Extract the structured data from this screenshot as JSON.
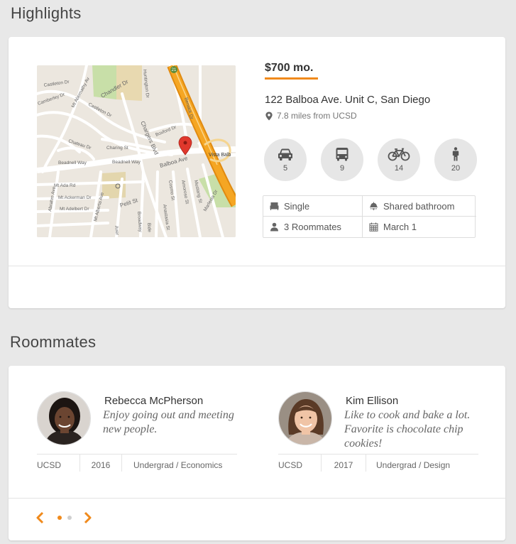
{
  "highlights": {
    "title": "Highlights",
    "price": "$700 mo.",
    "address": "122 Balboa Ave. Unit C, San Diego",
    "distance": "7.8 miles from UCSD",
    "transit": [
      {
        "icon": "car-icon",
        "value": "5"
      },
      {
        "icon": "bus-icon",
        "value": "9"
      },
      {
        "icon": "bicycle-icon",
        "value": "14"
      },
      {
        "icon": "walking-icon",
        "value": "20"
      }
    ],
    "features": [
      {
        "icon": "bed-icon",
        "label": "Single"
      },
      {
        "icon": "shower-icon",
        "label": "Shared bathroom"
      },
      {
        "icon": "person-icon",
        "label": "3 Roommates"
      },
      {
        "icon": "calendar-icon",
        "label": "March 1"
      }
    ],
    "map": {
      "labels": {
        "castleton1": "Castleton Dr",
        "castleton2": "Castleton Dr",
        "mt_abernathy": "Mt Abernathy Av",
        "chandler": "Chandler Dr",
        "chateau": "Chateau Dr",
        "charing": "Charing St",
        "chargers": "Chargers Blvd",
        "boxford": "Boxford Dr",
        "balboa": "Balboa Ave",
        "beadnell1": "Beadnell Way",
        "beadnell2": "Beadnell Way",
        "vista": "Vista Balb",
        "mt_ada": "Mt Ada Rd",
        "mt_ackerman": "Mt Ackerman Dr",
        "mt_adelbert": "Mt Adelbert Dr",
        "petit": "Petit St",
        "cosmo": "Cosmo St",
        "amoroso": "Amoroso St",
        "mustang": "Mustang St",
        "anastasia": "Anastasia St",
        "marlesta": "Marlesta Dr",
        "berwick": "Berwick Dr",
        "huntington": "Huntington Dr",
        "abrahm": "Abrahm Ave",
        "mt_alberta": "Mt Alberta Ave",
        "broadway": "Broadway",
        "avenue": "Aver",
        "hwy": "21",
        "camberley": "Camberley Dr",
        "bide": "Bide"
      },
      "colors": {
        "highway": "#f5a623",
        "highway_edge": "#e08a10",
        "park": "#c8dfa8",
        "land": "#ece7df",
        "block": "#d9cfb1",
        "marker": "#e0382c"
      }
    }
  },
  "roommates": {
    "title": "Roommates",
    "people": [
      {
        "name": "Rebecca McPherson",
        "quote": "Enjoy going out and meeting new people.",
        "school": "UCSD",
        "year": "2016",
        "program": "Undergrad / Economics"
      },
      {
        "name": "Kim Ellison",
        "quote": "Like to cook and bake a lot. Favorite is chocolate chip cookies!",
        "school": "UCSD",
        "year": "2017",
        "program": "Undergrad / Design"
      }
    ],
    "accent": "#f08a1c"
  }
}
